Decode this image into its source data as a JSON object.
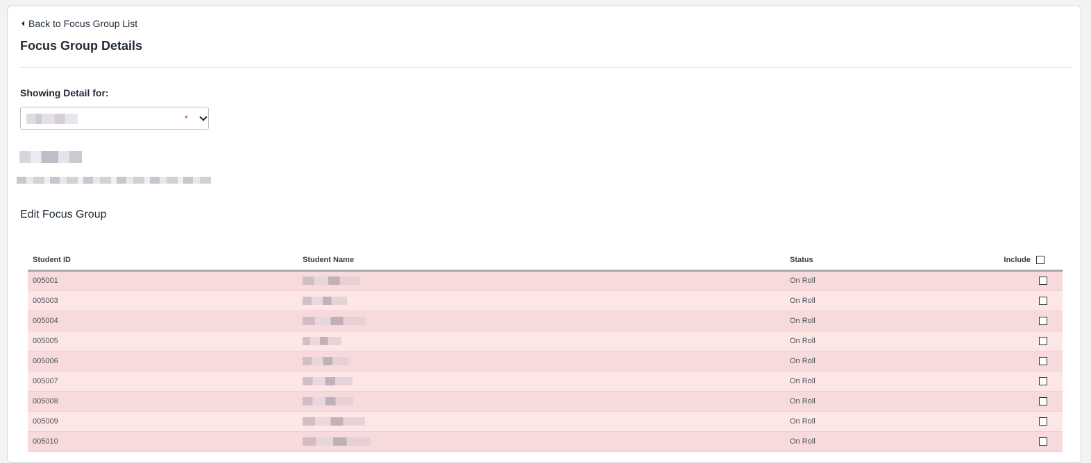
{
  "nav": {
    "back_label": "Back to Focus Group List"
  },
  "page": {
    "title": "Focus Group Details"
  },
  "filter": {
    "label": "Showing Detail for:",
    "required_marker": "*"
  },
  "section": {
    "title": "Edit Focus Group"
  },
  "table": {
    "headers": {
      "student_id": "Student ID",
      "student_name": "Student Name",
      "status": "Status",
      "include": "Include"
    },
    "rows": [
      {
        "id": "005001",
        "status": "On Roll"
      },
      {
        "id": "005003",
        "status": "On Roll"
      },
      {
        "id": "005004",
        "status": "On Roll"
      },
      {
        "id": "005005",
        "status": "On Roll"
      },
      {
        "id": "005006",
        "status": "On Roll"
      },
      {
        "id": "005007",
        "status": "On Roll"
      },
      {
        "id": "005008",
        "status": "On Roll"
      },
      {
        "id": "005009",
        "status": "On Roll"
      },
      {
        "id": "005010",
        "status": "On Roll"
      }
    ]
  },
  "colors": {
    "row_odd": "#f7dadb",
    "row_even": "#fde6e6",
    "required": "#dd1111"
  }
}
